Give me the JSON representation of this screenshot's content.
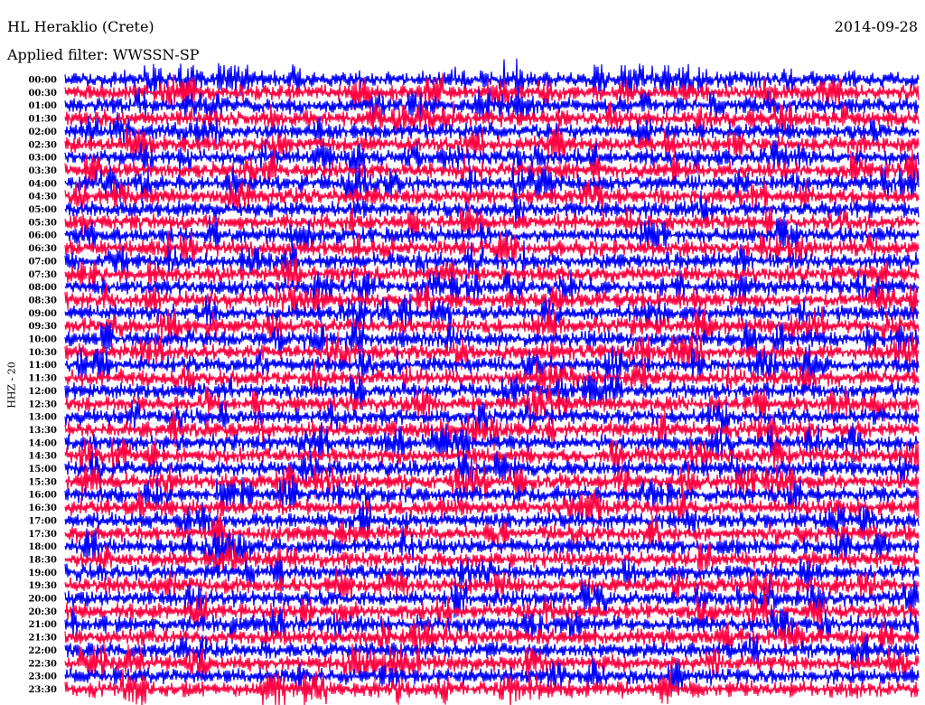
{
  "header": {
    "station": "HL Heraklio (Crete)",
    "date": "2014-09-28",
    "filter_label": "Applied filter: WWSSN-SP"
  },
  "chart_data": {
    "type": "line",
    "title": "HL Heraklio (Crete)",
    "ylabel": "HHZ - 20",
    "xlabel": "",
    "row_labels": [
      "00:00",
      "00:30",
      "01:00",
      "01:30",
      "02:00",
      "02:30",
      "03:00",
      "03:30",
      "04:00",
      "04:30",
      "05:00",
      "05:30",
      "06:00",
      "06:30",
      "07:00",
      "07:30",
      "08:00",
      "08:30",
      "09:00",
      "09:30",
      "10:00",
      "10:30",
      "11:00",
      "11:30",
      "12:00",
      "12:30",
      "13:00",
      "13:30",
      "14:00",
      "14:30",
      "15:00",
      "15:30",
      "16:00",
      "16:30",
      "17:00",
      "17:30",
      "18:00",
      "18:30",
      "19:00",
      "19:30",
      "20:00",
      "20:30",
      "21:00",
      "21:30",
      "22:00",
      "22:30",
      "23:00",
      "23:30"
    ],
    "trace_colors": [
      "#0000ff",
      "#ff0040"
    ],
    "grid": false
  }
}
